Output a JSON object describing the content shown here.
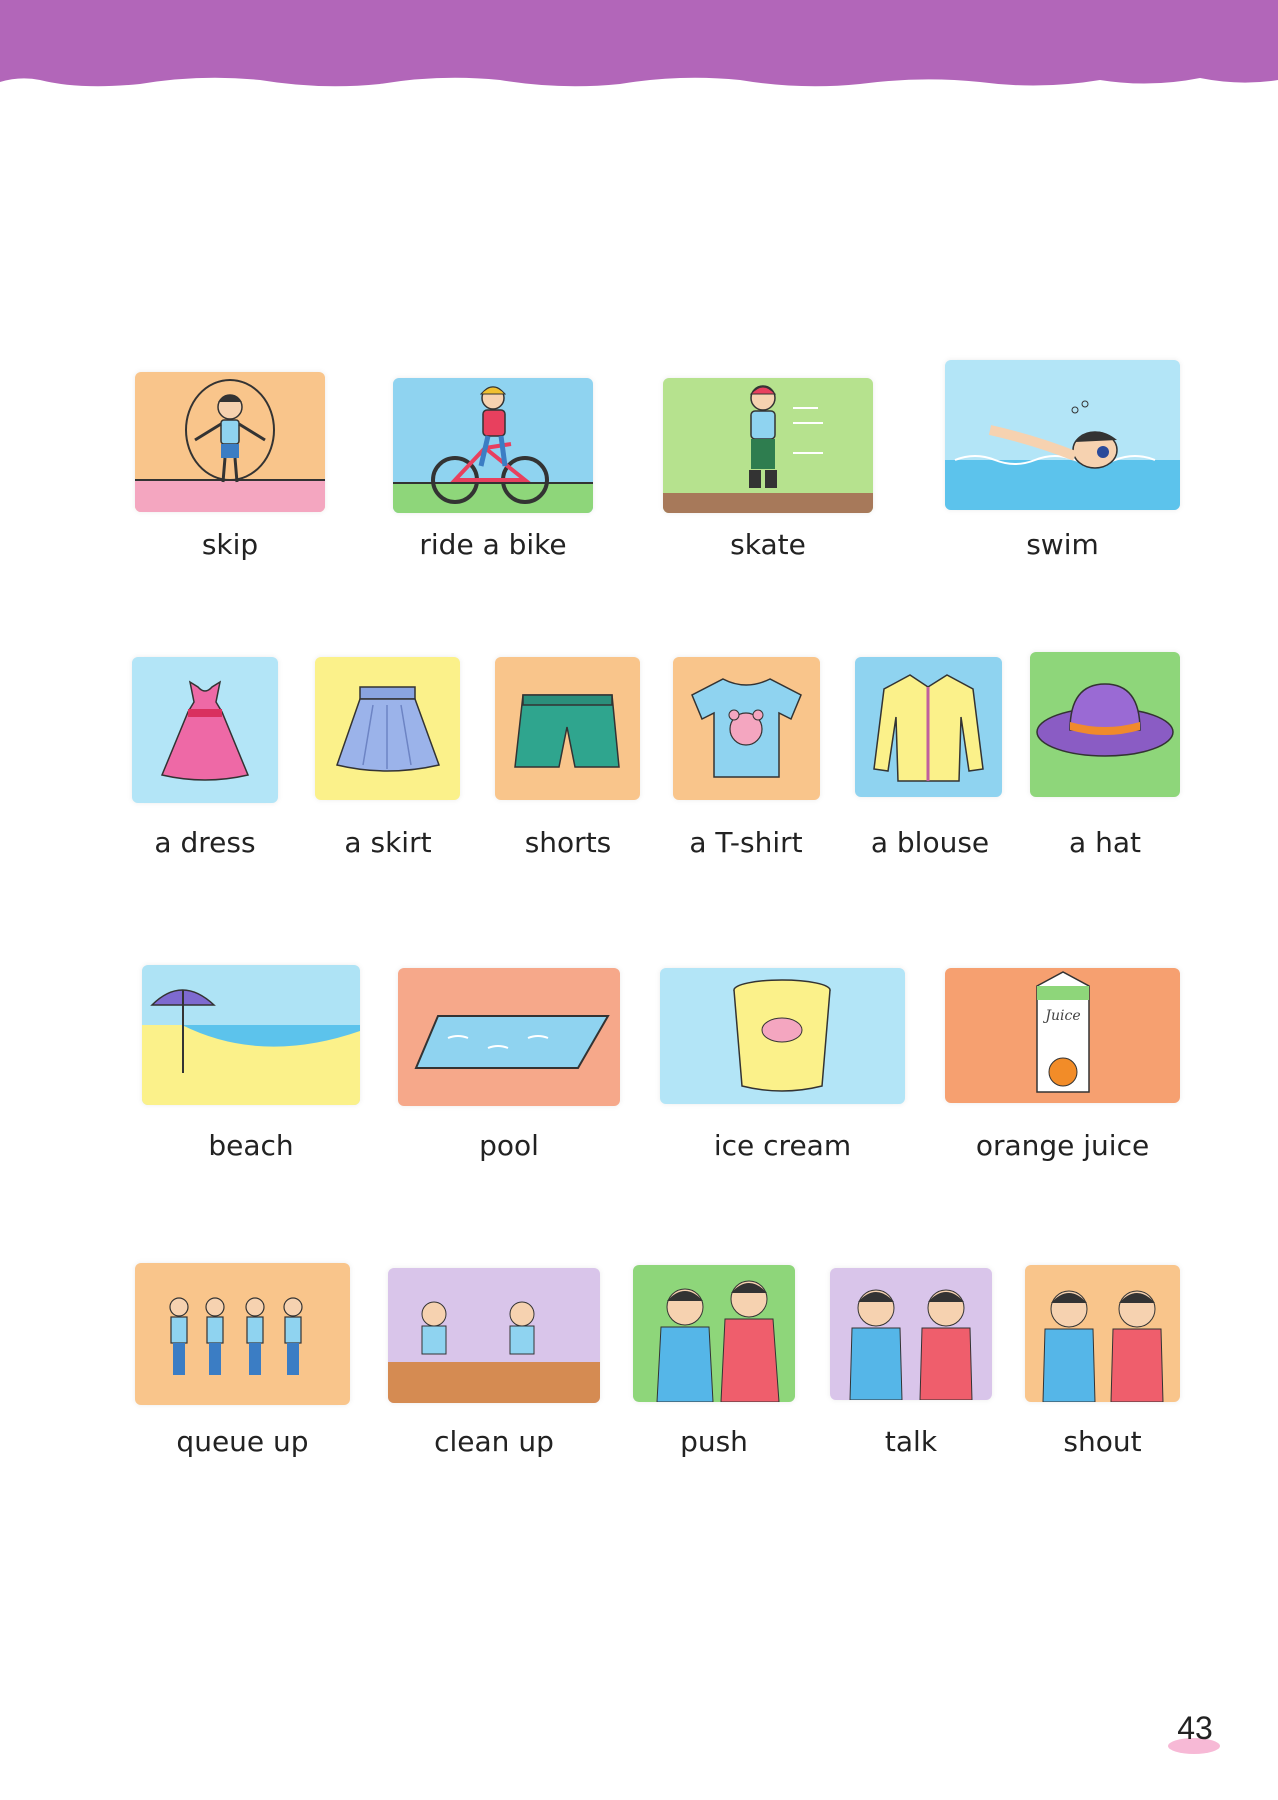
{
  "colors": {
    "banner": "#b266b9",
    "peach": "#f9c58b",
    "blue": "#aee3f5",
    "green": "#9bd97a",
    "pink": "#f4a6c0",
    "yellow": "#fbf18a",
    "salmon": "#f6a88a",
    "purple": "#d9c5ea"
  },
  "rows": [
    {
      "items": [
        {
          "label": "skip",
          "bg": "#f9c58b",
          "icon": "skip-rope-icon"
        },
        {
          "label": "ride a bike",
          "bg": "#8fd3f0",
          "icon": "bike-icon"
        },
        {
          "label": "skate",
          "bg": "#b6e28e",
          "icon": "skate-icon"
        },
        {
          "label": "swim",
          "bg": "#b3e5f7",
          "icon": "swimmer-icon"
        }
      ]
    },
    {
      "items": [
        {
          "label": "a dress",
          "bg": "#b3e5f7",
          "icon": "dress-icon"
        },
        {
          "label": "a skirt",
          "bg": "#fbf18a",
          "icon": "skirt-icon"
        },
        {
          "label": "shorts",
          "bg": "#f9c58b",
          "icon": "shorts-icon"
        },
        {
          "label": "a T-shirt",
          "bg": "#f9c58b",
          "icon": "tshirt-icon"
        },
        {
          "label": "a blouse",
          "bg": "#8fd3f0",
          "icon": "blouse-icon"
        },
        {
          "label": "a hat",
          "bg": "#8ed67a",
          "icon": "hat-icon"
        }
      ]
    },
    {
      "items": [
        {
          "label": "beach",
          "bg": "#aee3f5",
          "icon": "beach-umbrella-icon"
        },
        {
          "label": "pool",
          "bg": "#f6a88a",
          "icon": "pool-icon"
        },
        {
          "label": "ice cream",
          "bg": "#b3e5f7",
          "icon": "ice-cream-tub-icon"
        },
        {
          "label": "orange juice",
          "bg": "#f6a070",
          "icon": "juice-carton-icon"
        }
      ]
    },
    {
      "items": [
        {
          "label": "queue up",
          "bg": "#f9c58b",
          "icon": "queue-icon"
        },
        {
          "label": "clean up",
          "bg": "#d9c5ea",
          "icon": "clean-up-icon"
        },
        {
          "label": "push",
          "bg": "#8ed67a",
          "icon": "push-icon"
        },
        {
          "label": "talk",
          "bg": "#d9c5ea",
          "icon": "talk-icon"
        },
        {
          "label": "shout",
          "bg": "#f9c58b",
          "icon": "shout-icon"
        }
      ]
    }
  ],
  "juice_text": "Juice",
  "page_number": "43"
}
